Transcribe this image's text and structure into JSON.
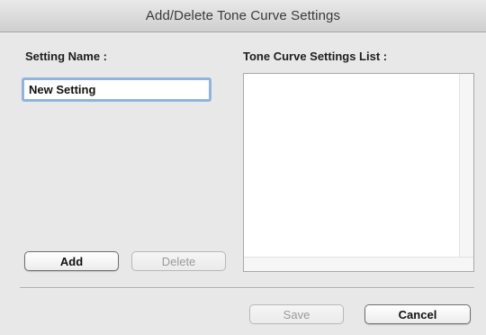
{
  "dialog": {
    "title": "Add/Delete Tone Curve Settings"
  },
  "setting_name": {
    "label": "Setting Name :",
    "value": "New Setting"
  },
  "settings_list": {
    "label": "Tone Curve Settings List :",
    "items": []
  },
  "buttons": {
    "add": "Add",
    "delete": "Delete",
    "save": "Save",
    "cancel": "Cancel"
  },
  "button_states": {
    "add": "enabled",
    "delete": "disabled",
    "save": "disabled",
    "cancel": "enabled"
  },
  "colors": {
    "window_background": "#e8e8e8",
    "focus_ring": "#8fb4de",
    "disabled_text": "#9a9a9a"
  }
}
